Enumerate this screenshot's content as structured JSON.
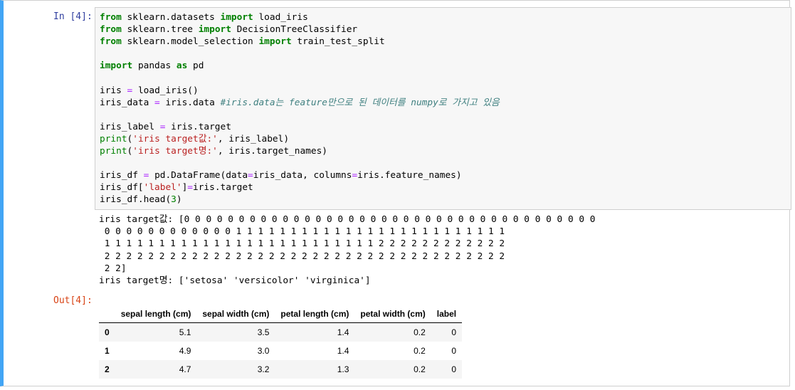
{
  "cell": {
    "in_prompt": "In [4]:",
    "out_prompt": "Out[4]:"
  },
  "code_lines": [
    [
      {
        "t": "from",
        "c": "kw"
      },
      {
        "t": " sklearn.datasets ",
        "c": ""
      },
      {
        "t": "import",
        "c": "kw"
      },
      {
        "t": " load_iris",
        "c": ""
      }
    ],
    [
      {
        "t": "from",
        "c": "kw"
      },
      {
        "t": " sklearn.tree ",
        "c": ""
      },
      {
        "t": "import",
        "c": "kw"
      },
      {
        "t": " DecisionTreeClassifier",
        "c": ""
      }
    ],
    [
      {
        "t": "from",
        "c": "kw"
      },
      {
        "t": " sklearn.model_selection ",
        "c": ""
      },
      {
        "t": "import",
        "c": "kw"
      },
      {
        "t": " train_test_split",
        "c": ""
      }
    ],
    [],
    [
      {
        "t": "import",
        "c": "kw"
      },
      {
        "t": " pandas ",
        "c": ""
      },
      {
        "t": "as",
        "c": "kw"
      },
      {
        "t": " pd",
        "c": ""
      }
    ],
    [],
    [
      {
        "t": "iris ",
        "c": ""
      },
      {
        "t": "=",
        "c": "op"
      },
      {
        "t": " load_iris()",
        "c": ""
      }
    ],
    [
      {
        "t": "iris_data ",
        "c": ""
      },
      {
        "t": "=",
        "c": "op"
      },
      {
        "t": " iris.data ",
        "c": ""
      },
      {
        "t": "#iris.data는 feature만으로 된 데이터를 numpy로 가지고 있음",
        "c": "cm"
      }
    ],
    [],
    [
      {
        "t": "iris_label ",
        "c": ""
      },
      {
        "t": "=",
        "c": "op"
      },
      {
        "t": " iris.target",
        "c": ""
      }
    ],
    [
      {
        "t": "print",
        "c": "bi"
      },
      {
        "t": "(",
        "c": ""
      },
      {
        "t": "'iris target값:'",
        "c": "st"
      },
      {
        "t": ", iris_label)",
        "c": ""
      }
    ],
    [
      {
        "t": "print",
        "c": "bi"
      },
      {
        "t": "(",
        "c": ""
      },
      {
        "t": "'iris target명:'",
        "c": "st"
      },
      {
        "t": ", iris.target_names)",
        "c": ""
      }
    ],
    [],
    [
      {
        "t": "iris_df ",
        "c": ""
      },
      {
        "t": "=",
        "c": "op"
      },
      {
        "t": " pd.DataFrame(data",
        "c": ""
      },
      {
        "t": "=",
        "c": "op"
      },
      {
        "t": "iris_data, columns",
        "c": ""
      },
      {
        "t": "=",
        "c": "op"
      },
      {
        "t": "iris.feature_names)",
        "c": ""
      }
    ],
    [
      {
        "t": "iris_df[",
        "c": ""
      },
      {
        "t": "'label'",
        "c": "st"
      },
      {
        "t": "]",
        "c": ""
      },
      {
        "t": "=",
        "c": "op"
      },
      {
        "t": "iris.target",
        "c": ""
      }
    ],
    [
      {
        "t": "iris_df.head(",
        "c": ""
      },
      {
        "t": "3",
        "c": "nu"
      },
      {
        "t": ")",
        "c": ""
      }
    ]
  ],
  "stdout_lines": [
    "iris target값: [0 0 0 0 0 0 0 0 0 0 0 0 0 0 0 0 0 0 0 0 0 0 0 0 0 0 0 0 0 0 0 0 0 0 0 0 0 0",
    " 0 0 0 0 0 0 0 0 0 0 0 0 1 1 1 1 1 1 1 1 1 1 1 1 1 1 1 1 1 1 1 1 1 1 1 1 1",
    " 1 1 1 1 1 1 1 1 1 1 1 1 1 1 1 1 1 1 1 1 1 1 1 1 1 2 2 2 2 2 2 2 2 2 2 2 2",
    " 2 2 2 2 2 2 2 2 2 2 2 2 2 2 2 2 2 2 2 2 2 2 2 2 2 2 2 2 2 2 2 2 2 2 2 2 2",
    " 2 2]",
    "iris target명: ['setosa' 'versicolor' 'virginica']"
  ],
  "dataframe": {
    "columns": [
      "sepal length (cm)",
      "sepal width (cm)",
      "petal length (cm)",
      "petal width (cm)",
      "label"
    ],
    "rows": [
      {
        "index": "0",
        "values": [
          "5.1",
          "3.5",
          "1.4",
          "0.2",
          "0"
        ]
      },
      {
        "index": "1",
        "values": [
          "4.9",
          "3.0",
          "1.4",
          "0.2",
          "0"
        ]
      },
      {
        "index": "2",
        "values": [
          "4.7",
          "3.2",
          "1.3",
          "0.2",
          "0"
        ]
      }
    ]
  }
}
